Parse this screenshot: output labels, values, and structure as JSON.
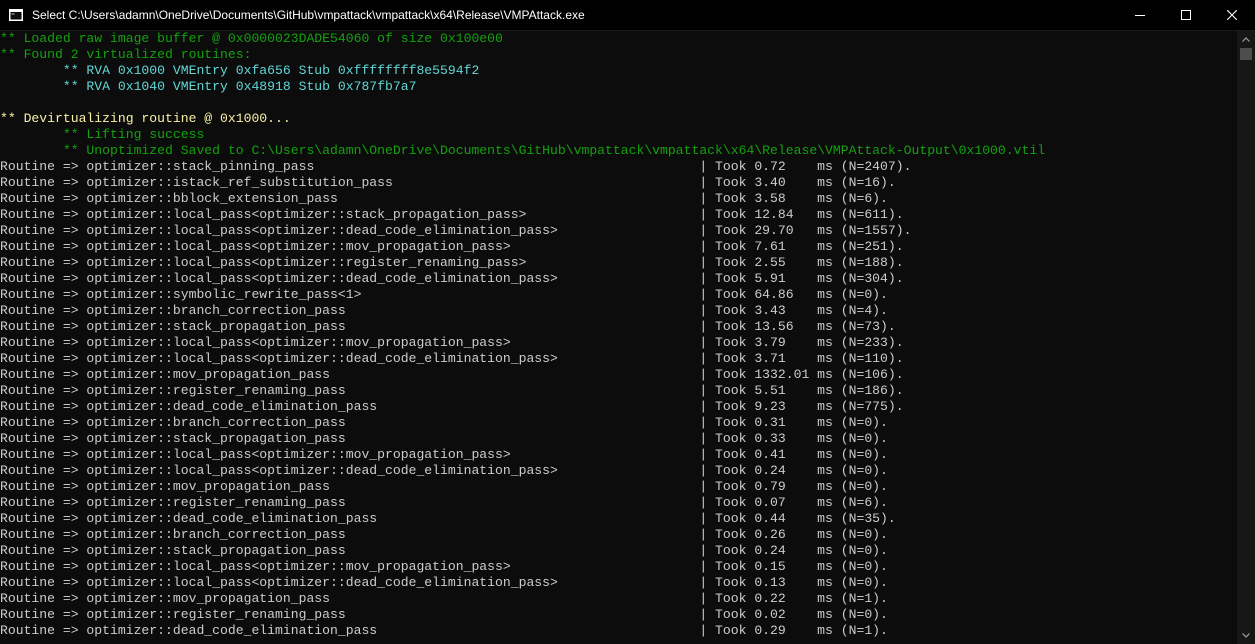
{
  "window": {
    "title": "Select C:\\Users\\adamn\\OneDrive\\Documents\\GitHub\\vmpattack\\vmpattack\\x64\\Release\\VMPAttack.exe"
  },
  "colors": {
    "background": "#0c0c0c",
    "default_text": "#cccccc",
    "green": "#13a10e",
    "aqua": "#3a96dd",
    "cyan": "#61d6d6",
    "yellow": "#f9f1a5"
  },
  "header_lines": [
    {
      "text": "** Loaded raw image buffer @ 0x0000023DADE54060 of size 0x100e00",
      "color": "green"
    },
    {
      "text": "** Found 2 virtualized routines:",
      "color": "green"
    },
    {
      "text": "        ** RVA 0x1000 VMEntry 0xfa656 Stub 0xffffffff8e5594f2",
      "color": "aqua2"
    },
    {
      "text": "        ** RVA 0x1040 VMEntry 0x48918 Stub 0x787fb7a7",
      "color": "aqua2"
    },
    {
      "text": "",
      "color": "grey"
    },
    {
      "text": "** Devirtualizing routine @ 0x1000...",
      "color": "yellow"
    },
    {
      "text": "        ** Lifting success",
      "color": "green"
    },
    {
      "text": "        ** Unoptimized Saved to C:\\Users\\adamn\\OneDrive\\Documents\\GitHub\\vmpattack\\vmpattack\\x64\\Release\\VMPAttack-Output\\0x1000.vtil",
      "color": "green"
    }
  ],
  "routine_lines": [
    {
      "pass": "optimizer::stack_pinning_pass",
      "took": "0.72",
      "n": "2407"
    },
    {
      "pass": "optimizer::istack_ref_substitution_pass",
      "took": "3.40",
      "n": "16"
    },
    {
      "pass": "optimizer::bblock_extension_pass",
      "took": "3.58",
      "n": "6"
    },
    {
      "pass": "optimizer::local_pass<optimizer::stack_propagation_pass>",
      "took": "12.84",
      "n": "611"
    },
    {
      "pass": "optimizer::local_pass<optimizer::dead_code_elimination_pass>",
      "took": "29.70",
      "n": "1557"
    },
    {
      "pass": "optimizer::local_pass<optimizer::mov_propagation_pass>",
      "took": "7.61",
      "n": "251"
    },
    {
      "pass": "optimizer::local_pass<optimizer::register_renaming_pass>",
      "took": "2.55",
      "n": "188"
    },
    {
      "pass": "optimizer::local_pass<optimizer::dead_code_elimination_pass>",
      "took": "5.91",
      "n": "304"
    },
    {
      "pass": "optimizer::symbolic_rewrite_pass<1>",
      "took": "64.86",
      "n": "0"
    },
    {
      "pass": "optimizer::branch_correction_pass",
      "took": "3.43",
      "n": "4"
    },
    {
      "pass": "optimizer::stack_propagation_pass",
      "took": "13.56",
      "n": "73"
    },
    {
      "pass": "optimizer::local_pass<optimizer::mov_propagation_pass>",
      "took": "3.79",
      "n": "233"
    },
    {
      "pass": "optimizer::local_pass<optimizer::dead_code_elimination_pass>",
      "took": "3.71",
      "n": "110"
    },
    {
      "pass": "optimizer::mov_propagation_pass",
      "took": "1332.01",
      "n": "106"
    },
    {
      "pass": "optimizer::register_renaming_pass",
      "took": "5.51",
      "n": "186"
    },
    {
      "pass": "optimizer::dead_code_elimination_pass",
      "took": "9.23",
      "n": "775"
    },
    {
      "pass": "optimizer::branch_correction_pass",
      "took": "0.31",
      "n": "0"
    },
    {
      "pass": "optimizer::stack_propagation_pass",
      "took": "0.33",
      "n": "0"
    },
    {
      "pass": "optimizer::local_pass<optimizer::mov_propagation_pass>",
      "took": "0.41",
      "n": "0"
    },
    {
      "pass": "optimizer::local_pass<optimizer::dead_code_elimination_pass>",
      "took": "0.24",
      "n": "0"
    },
    {
      "pass": "optimizer::mov_propagation_pass",
      "took": "0.79",
      "n": "0"
    },
    {
      "pass": "optimizer::register_renaming_pass",
      "took": "0.07",
      "n": "6"
    },
    {
      "pass": "optimizer::dead_code_elimination_pass",
      "took": "0.44",
      "n": "35"
    },
    {
      "pass": "optimizer::branch_correction_pass",
      "took": "0.26",
      "n": "0"
    },
    {
      "pass": "optimizer::stack_propagation_pass",
      "took": "0.24",
      "n": "0"
    },
    {
      "pass": "optimizer::local_pass<optimizer::mov_propagation_pass>",
      "took": "0.15",
      "n": "0"
    },
    {
      "pass": "optimizer::local_pass<optimizer::dead_code_elimination_pass>",
      "took": "0.13",
      "n": "0"
    },
    {
      "pass": "optimizer::mov_propagation_pass",
      "took": "0.22",
      "n": "1"
    },
    {
      "pass": "optimizer::register_renaming_pass",
      "took": "0.02",
      "n": "0"
    },
    {
      "pass": "optimizer::dead_code_elimination_pass",
      "took": "0.29",
      "n": "1"
    }
  ],
  "routine_format": {
    "prefix": "Routine => ",
    "separator": "| Took ",
    "unit": "ms"
  },
  "icons": {
    "app": "console-app-icon",
    "minimize": "minimize-icon",
    "maximize": "maximize-icon",
    "close": "close-icon",
    "scroll_up": "chevron-up-icon",
    "scroll_down": "chevron-down-icon"
  }
}
